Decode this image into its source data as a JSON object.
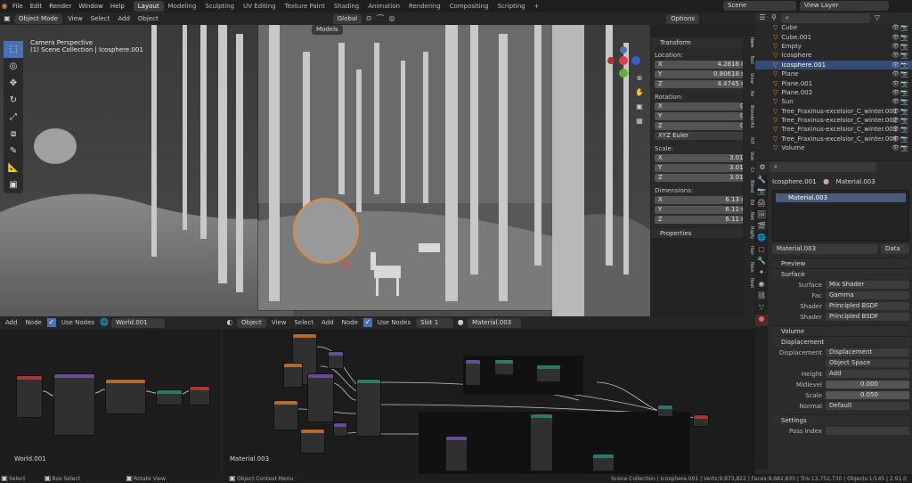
{
  "menu": {
    "items": [
      "File",
      "Edit",
      "Render",
      "Window",
      "Help"
    ]
  },
  "workspaces": [
    "Layout",
    "Modeling",
    "Sculpting",
    "UV Editing",
    "Texture Paint",
    "Shading",
    "Animation",
    "Rendering",
    "Compositing",
    "Scripting"
  ],
  "scene": {
    "label": "Scene",
    "view_layer": "View Layer"
  },
  "viewport": {
    "mode": "Object Mode",
    "menus": [
      "View",
      "Select",
      "Add",
      "Object"
    ],
    "orientation": "Global",
    "collection_menu": "Models",
    "options": "Options",
    "title": "Camera Perspective",
    "subtitle": "(1) Scene Collection | Icosphere.001"
  },
  "transform": {
    "header": "Transform",
    "location_label": "Location:",
    "loc": [
      "4.2816 m",
      "0.80618 m",
      "4.4745 m"
    ],
    "rotation_label": "Rotation:",
    "rot": [
      "0°",
      "0°",
      "0°"
    ],
    "euler": "XYZ Euler",
    "scale_label": "Scale:",
    "scale": [
      "3.012",
      "3.012",
      "3.012"
    ],
    "dimensions_label": "Dimensions:",
    "dims": [
      "6.13 m",
      "6.11 m",
      "6.11 m"
    ],
    "properties": "Properties",
    "axes": [
      "X",
      "Y",
      "Z"
    ]
  },
  "side_tabs": [
    "Item",
    "Tool",
    "View",
    "Re",
    "BlenderKit",
    "RIT",
    "Stat",
    "Cr",
    "Blend",
    "Ed",
    "Rek",
    "Rigify",
    "Hair",
    "Rock",
    "Real"
  ],
  "outliner": {
    "items": [
      {
        "name": "Cube",
        "sel": false
      },
      {
        "name": "Cube.001",
        "sel": false
      },
      {
        "name": "Empty",
        "sel": false
      },
      {
        "name": "Icosphere",
        "sel": false
      },
      {
        "name": "Icosphere.001",
        "sel": true
      },
      {
        "name": "Plane",
        "sel": false
      },
      {
        "name": "Plane.001",
        "sel": false
      },
      {
        "name": "Plane.002",
        "sel": false
      },
      {
        "name": "Sun",
        "sel": false
      },
      {
        "name": "Tree_Fraxinus-excelsior_C_winter.001",
        "sel": false
      },
      {
        "name": "Tree_Fraxinus-excelsior_C_winter.002",
        "sel": false
      },
      {
        "name": "Tree_Fraxinus-excelsior_C_winter.003",
        "sel": false
      },
      {
        "name": "Tree_Fraxinus-excelsior_C_winter.004",
        "sel": false
      },
      {
        "name": "Volume",
        "sel": false
      }
    ]
  },
  "props": {
    "object": "Icosphere.001",
    "material": "Material.003",
    "slot": "Material.003",
    "material_field": "Material.003",
    "data": "Data",
    "preview": "Preview",
    "surface_sec": "Surface",
    "surface_label": "Surface",
    "surface_val": "Mix Shader",
    "fac_label": "Fac",
    "fac_val": "Gamma",
    "shader1_label": "Shader",
    "shader1_val": "Principled BSDF",
    "shader2_label": "Shader",
    "shader2_val": "Principled BSDF",
    "volume": "Volume",
    "displacement_sec": "Displacement",
    "disp_label": "Displacement",
    "disp_val": "Displacement",
    "space": "Object Space",
    "height_label": "Height",
    "height_val": "Add",
    "midlevel_label": "Midlevel",
    "midlevel_val": "0.000",
    "scale_label": "Scale",
    "scale_val": "0.050",
    "normal_label": "Normal",
    "normal_val": "Default",
    "settings": "Settings",
    "pass_index": "Pass Index"
  },
  "world_editor": {
    "menus": [
      "Add",
      "Node"
    ],
    "use_nodes": "Use Nodes",
    "world": "World.001",
    "label": "World.001"
  },
  "shader_editor": {
    "type": "Object",
    "menus": [
      "View",
      "Select",
      "Add",
      "Node"
    ],
    "use_nodes": "Use Nodes",
    "slot": "Slot 1",
    "material": "Material.003",
    "label": "Material.003"
  },
  "status": {
    "select": "Select",
    "box_select": "Box Select",
    "rotate": "Rotate View",
    "context": "Object Context Menu",
    "stats": "Scene Collection | Icosphere.001 | Verts:9,973,822 | Faces:9,682,830 | Tris:13,752,730 | Objects:1/145 | 2.91.0"
  },
  "colors": {
    "accent": "#e08a3c",
    "selection": "#334b7a",
    "node_header_teal": "#2a7a6a",
    "node_header_red": "#a33",
    "node_header_purple": "#6a4a9a",
    "node_header_orange": "#b86a2a"
  }
}
